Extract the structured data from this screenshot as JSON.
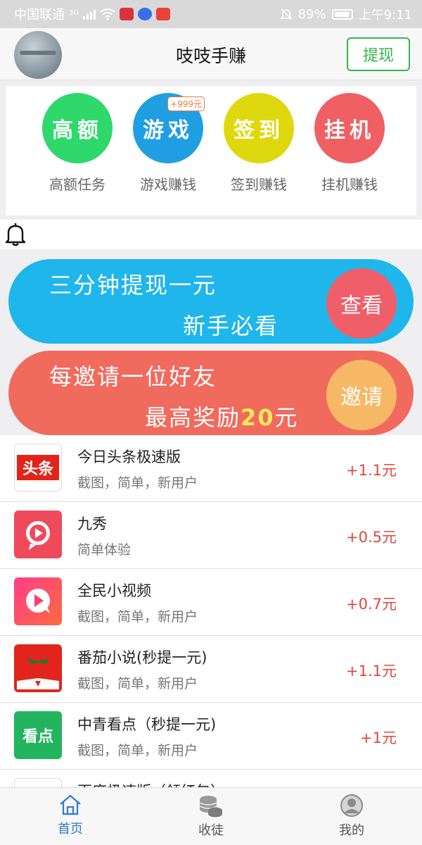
{
  "status_bar": {
    "carrier": "中国联通",
    "network": "3G",
    "battery": "89%",
    "time": "上午9:11"
  },
  "header": {
    "title": "吱吱手赚",
    "withdraw_label": "提现"
  },
  "categories": [
    {
      "circle_text": "高额",
      "label": "高额任务",
      "color": "#2fd86b"
    },
    {
      "circle_text": "游戏",
      "label": "游戏赚钱",
      "color": "#1f9fe2",
      "badge": "+999元"
    },
    {
      "circle_text": "签到",
      "label": "签到赚钱",
      "color": "#e0d80f"
    },
    {
      "circle_text": "挂机",
      "label": "挂机赚钱",
      "color": "#ef5f64"
    }
  ],
  "banners": [
    {
      "line1": "三分钟提现一元",
      "line2": "新手必看",
      "button": "查看",
      "color": "#1fb6ec"
    },
    {
      "line1": "每邀请一位好友",
      "line2_prefix": "最高奖励",
      "line2_highlight": "20",
      "line2_suffix": "元",
      "button": "邀请",
      "color": "#f06a5e"
    }
  ],
  "tasks": [
    {
      "name": "今日头条极速版",
      "desc": "截图，简单，新用户",
      "reward": "+1.1元",
      "icon": "toutiao-icon",
      "icon_text": "头条"
    },
    {
      "name": "九秀",
      "desc": "简单体验",
      "reward": "+0.5元",
      "icon": "play-bubble-icon"
    },
    {
      "name": "全民小视频",
      "desc": "截图，简单，新用户",
      "reward": "+0.7元",
      "icon": "video-bubble-icon"
    },
    {
      "name": "番茄小说(秒提一元)",
      "desc": "截图，简单，新用户",
      "reward": "+1.1元",
      "icon": "tomato-icon"
    },
    {
      "name": "中青看点（秒提一元)",
      "desc": "截图，简单，新用户",
      "reward": "+1元",
      "icon": "kandian-icon",
      "icon_text": "看点"
    },
    {
      "name": "百度极速版（领红包）",
      "desc": "",
      "reward": "",
      "icon": "baidu-icon"
    }
  ],
  "tabbar": [
    {
      "label": "首页",
      "icon": "home-icon",
      "active": true
    },
    {
      "label": "收徒",
      "icon": "coins-icon",
      "active": false
    },
    {
      "label": "我的",
      "icon": "user-icon",
      "active": false
    }
  ],
  "colors": {
    "accent_green": "#35b54a",
    "reward_red": "#e0473d",
    "tab_active": "#2f7ad4"
  }
}
